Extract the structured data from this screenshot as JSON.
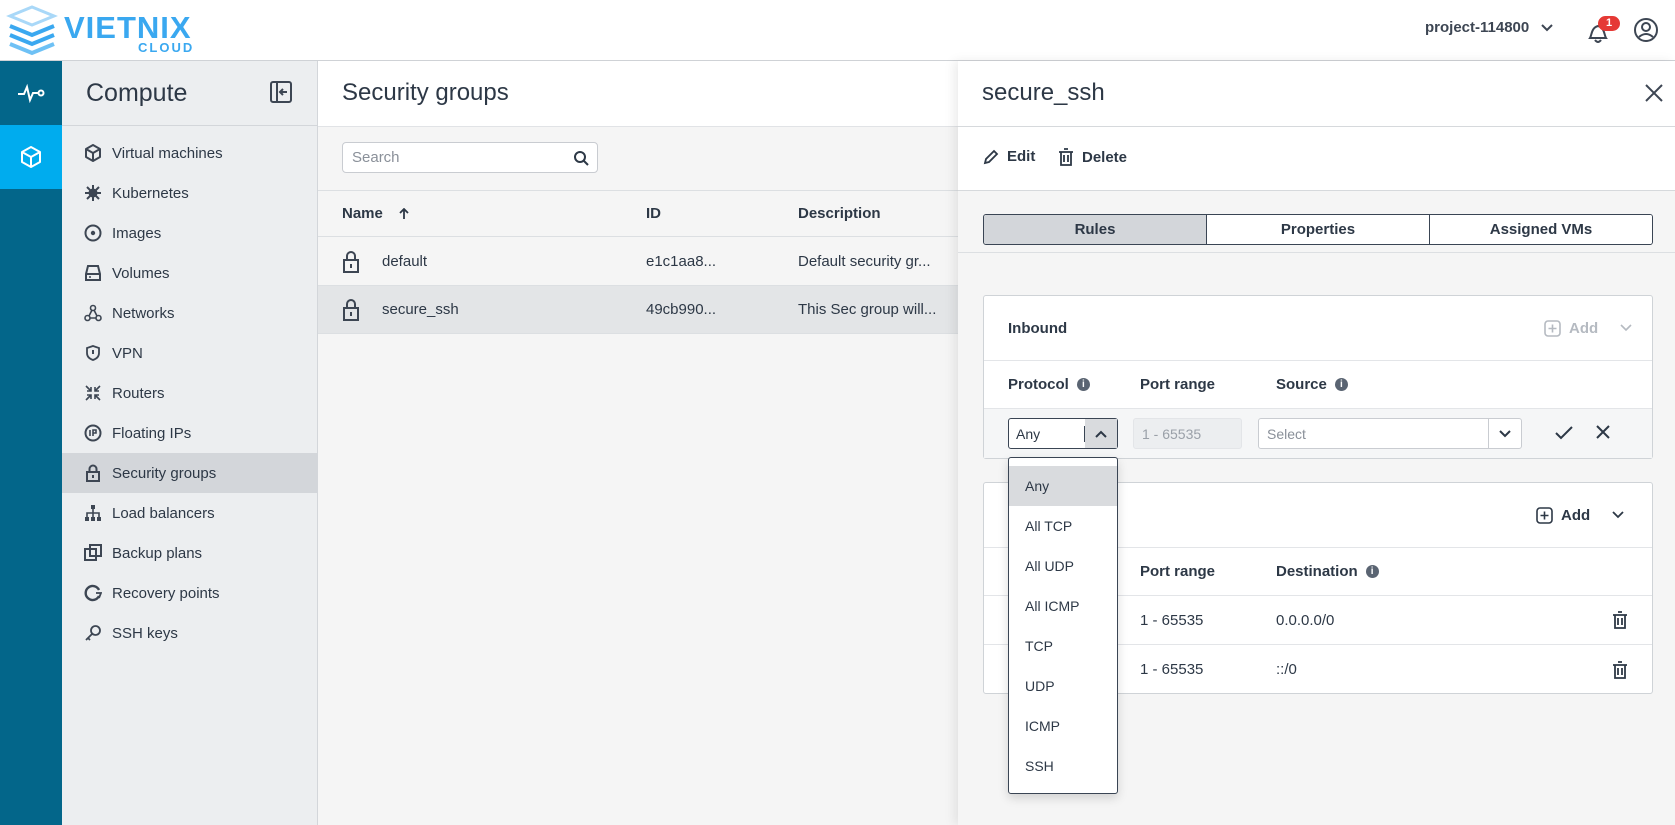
{
  "brand": {
    "name": "VIETNIX",
    "sub": "CLOUD",
    "color": "#3aa8f0"
  },
  "header": {
    "project": "project-114800",
    "notification_count": "1"
  },
  "colors": {
    "rail": "#03668a",
    "rail_active": "#00acee",
    "badge": "#e53935"
  },
  "rail": [
    {
      "icon": "activity-icon"
    },
    {
      "icon": "cube-icon",
      "active": true
    }
  ],
  "sidebar": {
    "title": "Compute",
    "items": [
      {
        "label": "Virtual machines",
        "icon": "cube-icon"
      },
      {
        "label": "Kubernetes",
        "icon": "helm-icon"
      },
      {
        "label": "Images",
        "icon": "disc-icon"
      },
      {
        "label": "Volumes",
        "icon": "drive-icon"
      },
      {
        "label": "Networks",
        "icon": "network-icon"
      },
      {
        "label": "VPN",
        "icon": "shield-icon"
      },
      {
        "label": "Routers",
        "icon": "router-icon"
      },
      {
        "label": "Floating IPs",
        "icon": "ip-icon"
      },
      {
        "label": "Security groups",
        "icon": "lock-icon",
        "active": true
      },
      {
        "label": "Load balancers",
        "icon": "sitemap-icon"
      },
      {
        "label": "Backup plans",
        "icon": "copy-icon"
      },
      {
        "label": "Recovery points",
        "icon": "recovery-icon"
      },
      {
        "label": "SSH keys",
        "icon": "key-icon"
      }
    ]
  },
  "main": {
    "title": "Security groups",
    "search_placeholder": "Search",
    "columns": [
      "Name",
      "ID",
      "Description"
    ],
    "rows": [
      {
        "name": "default",
        "id": "e1c1aa8...",
        "description": "Default security gr..."
      },
      {
        "name": "secure_ssh",
        "id": "49cb990...",
        "description": "This Sec group will...",
        "selected": true
      }
    ]
  },
  "panel": {
    "title": "secure_ssh",
    "edit": "Edit",
    "delete": "Delete",
    "tabs": [
      {
        "label": "Rules",
        "active": true
      },
      {
        "label": "Properties"
      },
      {
        "label": "Assigned VMs"
      }
    ],
    "inbound": {
      "title": "Inbound",
      "add": "Add",
      "columns": [
        "Protocol",
        "Port range",
        "Source"
      ],
      "edit_row": {
        "protocol": "Any",
        "port_range": "1 - 65535",
        "source_placeholder": "Select"
      }
    },
    "outbound": {
      "add": "Add",
      "columns": [
        "Port range",
        "Destination"
      ],
      "rows": [
        {
          "port_range": "1 - 65535",
          "destination": "0.0.0.0/0"
        },
        {
          "port_range": "1 - 65535",
          "destination": "::/0"
        }
      ]
    },
    "protocol_options": [
      "Any",
      "All TCP",
      "All UDP",
      "All ICMP",
      "TCP",
      "UDP",
      "ICMP",
      "SSH"
    ],
    "highlighted_option": "Any"
  }
}
